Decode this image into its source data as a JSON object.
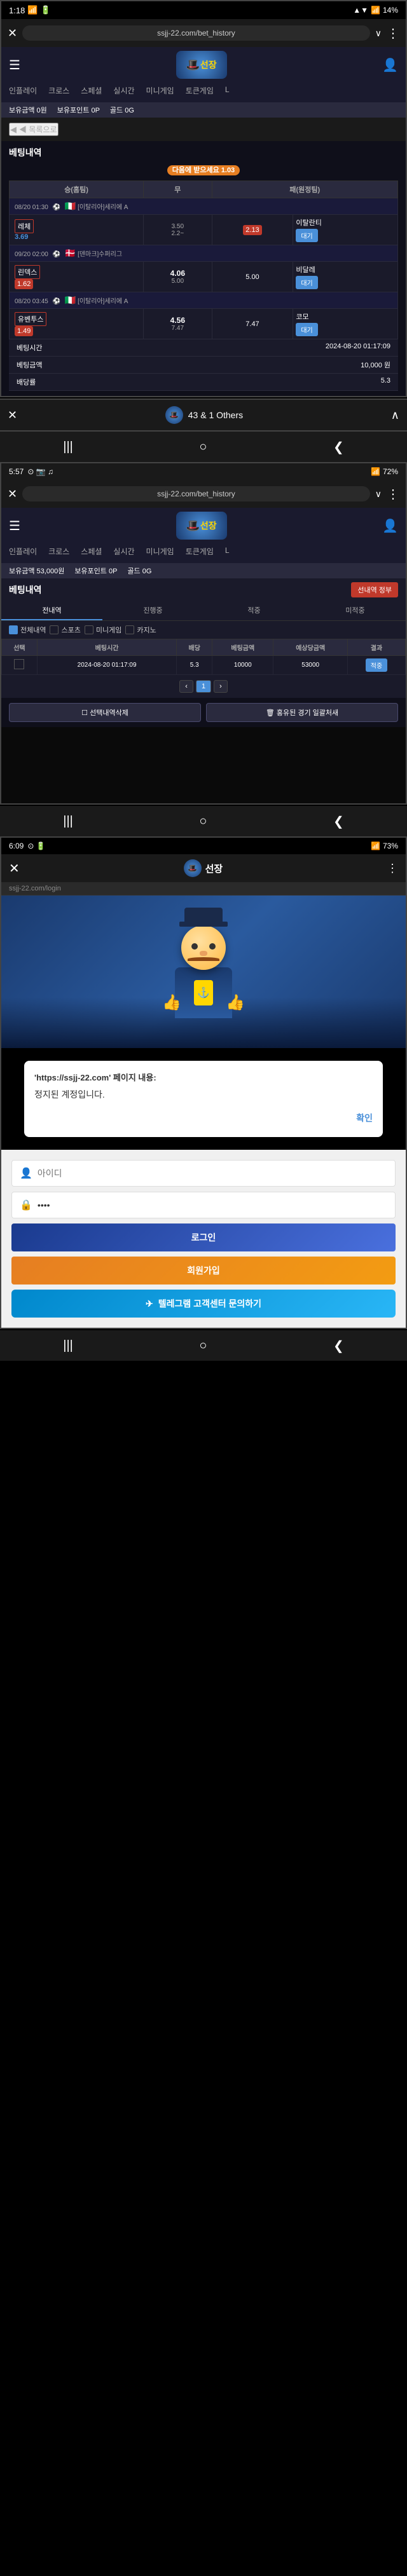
{
  "app": {
    "title": "선장"
  },
  "window1": {
    "status": {
      "time": "1:18",
      "battery": "14%",
      "signal": "▲▼",
      "wifi": "WiFi"
    },
    "browser": {
      "close_label": "✕",
      "url": "ssjj-22.com/bet_history",
      "more_label": "⋮"
    },
    "nav": {
      "hamburger": "☰",
      "logo_text": "선장",
      "user_icon": "👤"
    },
    "tabs": [
      {
        "label": "인플레이",
        "active": false
      },
      {
        "label": "크로스",
        "active": false
      },
      {
        "label": "스페셜",
        "active": false
      },
      {
        "label": "실시간",
        "active": false
      },
      {
        "label": "미니게임",
        "active": false
      },
      {
        "label": "토큰게임",
        "active": false
      }
    ],
    "balance": {
      "label1": "보유금액",
      "val1": "0원",
      "label2": "보유포인트",
      "val2": "0P",
      "label3": "골드",
      "val3": "0G"
    },
    "back_btn": "◀ 목록으로",
    "page_title": "베팅내역",
    "multiplier_label": "다음에 받으세요",
    "multiplier_val": "1.03",
    "matches": [
      {
        "date": "08/20 01:30",
        "sport": "⚽",
        "league": "[이탈리아]세리에 A",
        "team_home": "레체",
        "score_home": "3.69",
        "draw": "3.50",
        "score_away": "2.13",
        "team_away": "이탈란티",
        "result": "대기",
        "highlight": "away"
      },
      {
        "date": "09/20 02:00",
        "sport": "⚽",
        "league": "[덴마크]수퍼리그",
        "team_home": "린덱스",
        "score_home": "1.62",
        "draw": "4.06",
        "score_away": "5.00",
        "team_away": "비달레",
        "result": "대기",
        "highlight": "home"
      },
      {
        "date": "08/20 03:45",
        "sport": "⚽",
        "league": "[이탈리아]세리에 A",
        "team_home": "유벤투스",
        "score_home": "1.49",
        "draw": "4.56",
        "score_away": "7.47",
        "team_away": "코모",
        "result": "대기",
        "highlight": "home"
      }
    ],
    "info_rows": [
      {
        "label": "베팅시간",
        "value": "2024-08-20 01:17:09"
      },
      {
        "label": "베팅금액",
        "value": "10,000 원"
      },
      {
        "label": "배당률",
        "value": "5.3"
      }
    ]
  },
  "task_switch": {
    "label": "43 & 1 Others",
    "close": "✕",
    "expand": "∧"
  },
  "window2": {
    "status": {
      "time": "5:57",
      "icons": "⊙ 📷 ♫",
      "battery": "72%",
      "signal": "4G"
    },
    "browser": {
      "close_label": "✕",
      "url": "ssjj-22.com/bet_history",
      "more_label": "⋮",
      "down_label": "∨"
    },
    "balance": {
      "label1": "보유금액",
      "val1": "53,000원",
      "label2": "보유포인트",
      "val2": "0P",
      "label3": "골드",
      "val3": "0G"
    },
    "section_title": "베팅내역",
    "manage_btn": "선내역 정부",
    "filter_tabs": [
      {
        "label": "전내역",
        "active": true
      },
      {
        "label": "진행중",
        "active": false
      },
      {
        "label": "적중",
        "active": false
      },
      {
        "label": "미적중",
        "active": false
      }
    ],
    "filter_row2": [
      {
        "label": "전체내역",
        "checked": true
      },
      {
        "label": "스포츠",
        "checked": false
      },
      {
        "label": "미니게임",
        "checked": false
      },
      {
        "label": "카지노",
        "checked": false
      }
    ],
    "table_headers": [
      "선택",
      "베팅시간",
      "배당",
      "베팅금액",
      "예상당금액",
      "결과"
    ],
    "bet_rows": [
      {
        "checked": false,
        "time": "2024-08-20 01:17:09",
        "odds": "5.3",
        "amount": "10000",
        "expected": "53000",
        "result": "적중"
      }
    ],
    "pagination": {
      "prev": "‹",
      "current": "1",
      "next": "›"
    },
    "bottom_btns": [
      "선택내역삭제",
      "홍유된 경기 일괄처새"
    ]
  },
  "window3": {
    "status": {
      "time": "6:09",
      "icons": "⊙ 🔋",
      "battery": "73%",
      "signal": "4G"
    },
    "header": {
      "close_label": "✕",
      "title": "선장",
      "more_label": "⋮",
      "url": "ssjj-22.com/login"
    },
    "hero": {
      "character_text": "🎩",
      "overlay_text": ""
    },
    "alert": {
      "title": "'https://ssjj-22.com' 페이지 내용:",
      "body": "정지된 계정입니다.",
      "confirm_btn": "확인"
    },
    "login": {
      "id_placeholder": "아이디",
      "id_icon": "👤",
      "pw_placeholder": "••••",
      "pw_icon": "🔒",
      "login_btn": "로그인",
      "register_btn": "회원가입",
      "telegram_btn": "텔레그램 고객센터 문의하기",
      "telegram_icon": "✈"
    }
  },
  "system_nav": {
    "back": "❮",
    "home": "⬤",
    "recent": "▣"
  }
}
